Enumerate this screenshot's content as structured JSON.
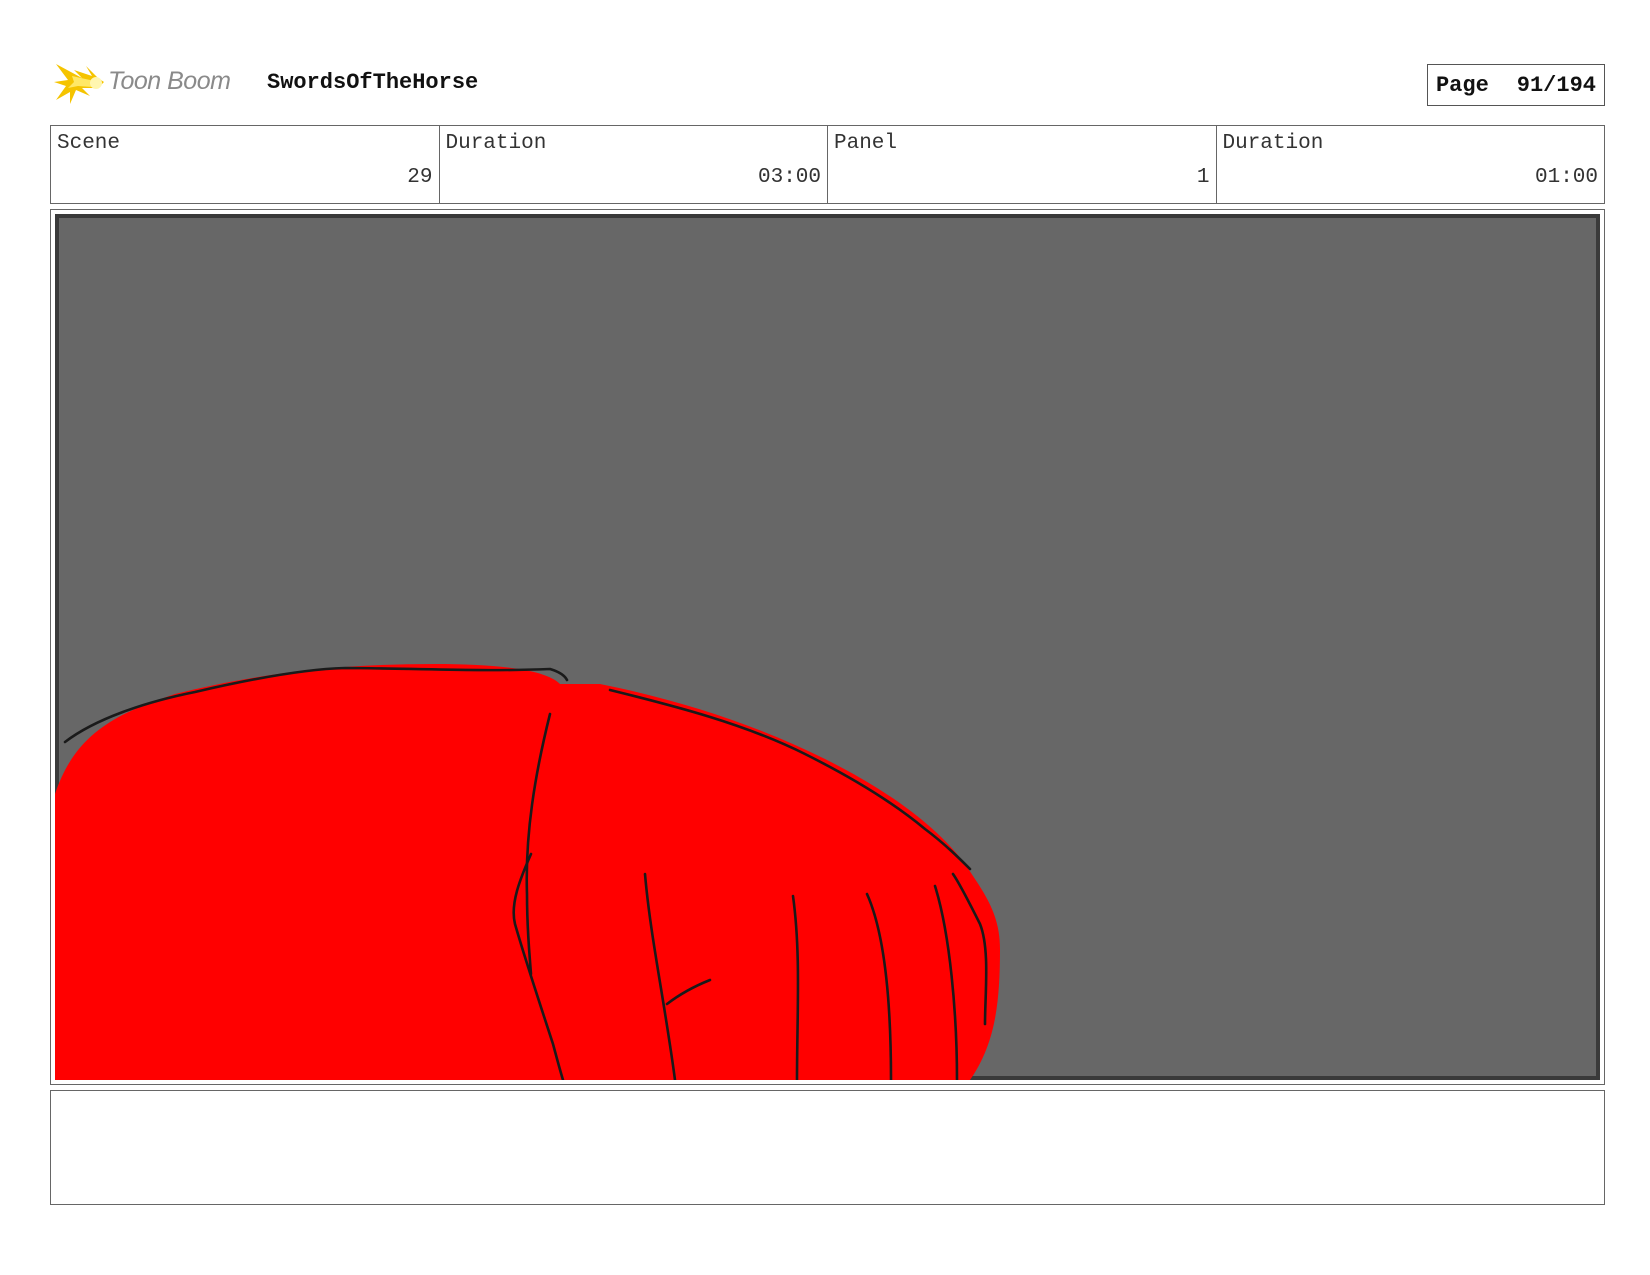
{
  "header": {
    "brand": "Toon Boom",
    "project": "SwordsOfTheHorse",
    "page_label": "Page",
    "page_value": "91/194"
  },
  "info": [
    {
      "label": "Scene",
      "value": "29"
    },
    {
      "label": "Duration",
      "value": "03:00"
    },
    {
      "label": "Panel",
      "value": "1"
    },
    {
      "label": "Duration",
      "value": "01:00"
    }
  ],
  "panel": {
    "background_color": "#676767",
    "fill_color": "#ff0000",
    "line_color": "#1a1a1a"
  },
  "notes": {
    "text": ""
  }
}
